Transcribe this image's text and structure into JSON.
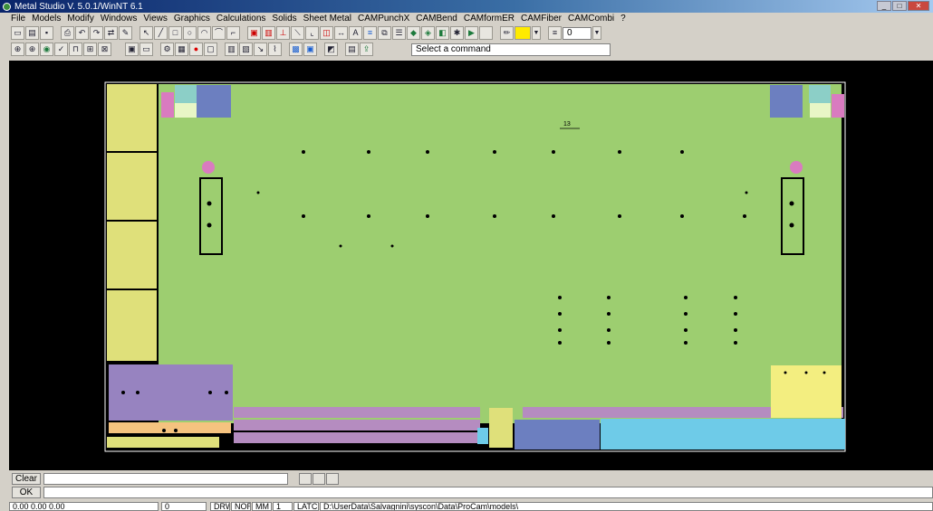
{
  "window": {
    "title": "Metal Studio V. 5.0.1/WinNT 6.1"
  },
  "menu": [
    "File",
    "Models",
    "Modify",
    "Windows",
    "Views",
    "Graphics",
    "Calculations",
    "Solids",
    "Sheet Metal",
    "CAMPunchX",
    "CAMBend",
    "CAMformER",
    "CAMFiber",
    "CAMCombi",
    "?"
  ],
  "toolbar": {
    "layer_value": "0",
    "command_prompt": "Select a command"
  },
  "drawing": {
    "dimension_label": "13"
  },
  "bottom": {
    "clear_label": "Clear",
    "ok_label": "OK"
  },
  "statusbar": {
    "coords": "0.00  0.00  0.00",
    "count": "0",
    "mode1": "DRW",
    "mode2": "NOR",
    "units": "MM",
    "scale": "1",
    "latch": "LATCH",
    "path": "D:\\UserData\\Salvagnini\\syscon\\Data\\ProCam\\models\\"
  },
  "colors": {
    "sheet": "#9dce70",
    "yellow": "#dfe07a",
    "purple": "#9783c0",
    "violet": "#b58cc0",
    "cyan": "#6ecbe8",
    "teal": "#8ccfc7",
    "pink": "#d97bc0",
    "orange": "#f5c37f",
    "lightyellow": "#f3ee80",
    "steel": "#6c7fc0"
  }
}
